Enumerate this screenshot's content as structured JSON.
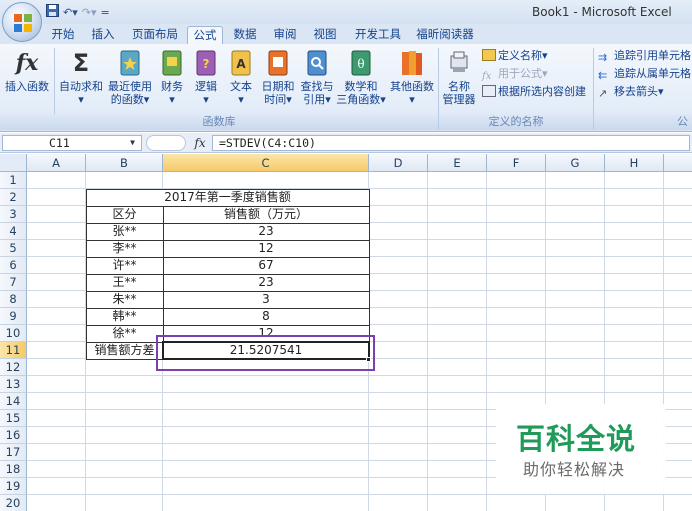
{
  "window": {
    "title": "Book1 - Microsoft Excel"
  },
  "tabs": [
    {
      "label": "开始"
    },
    {
      "label": "插入"
    },
    {
      "label": "页面布局"
    },
    {
      "label": "公式",
      "active": true
    },
    {
      "label": "数据"
    },
    {
      "label": "审阅"
    },
    {
      "label": "视图"
    },
    {
      "label": "开发工具"
    },
    {
      "label": "福昕阅读器"
    }
  ],
  "ribbon": {
    "function_library": {
      "group_label": "函数库",
      "buttons": [
        {
          "line1": "插入函数",
          "line2": "",
          "icon": "fx-icon"
        },
        {
          "line1": "自动求和",
          "line2": "▾",
          "icon": "sigma-icon"
        },
        {
          "line1": "最近使用",
          "line2": "的函数▾",
          "icon": "book-star-icon"
        },
        {
          "line1": "财务",
          "line2": "▾",
          "icon": "book-finance-icon"
        },
        {
          "line1": "逻辑",
          "line2": "▾",
          "icon": "book-logic-icon"
        },
        {
          "line1": "文本",
          "line2": "▾",
          "icon": "book-text-icon"
        },
        {
          "line1": "日期和",
          "line2": "时间▾",
          "icon": "book-date-icon"
        },
        {
          "line1": "查找与",
          "line2": "引用▾",
          "icon": "book-lookup-icon"
        },
        {
          "line1": "数学和",
          "line2": "三角函数▾",
          "icon": "book-math-icon"
        },
        {
          "line1": "其他函数",
          "line2": "▾",
          "icon": "book-more-icon"
        }
      ]
    },
    "defined_names": {
      "group_label": "定义的名称",
      "name_manager": {
        "line1": "名称",
        "line2": "管理器"
      },
      "define_name": "定义名称▾",
      "use_in_formula": "用于公式▾",
      "create_from_selection": "根据所选内容创建"
    },
    "formula_auditing": {
      "trace_precedents": "追踪引用单元格",
      "trace_dependents": "追踪从属单元格",
      "remove_arrows": "移去箭头▾",
      "group_label_partial": "公"
    }
  },
  "formula_bar": {
    "name_box": "C11",
    "fx_label": "fx",
    "formula": "=STDEV(C4:C10)"
  },
  "columns": [
    "A",
    "B",
    "C",
    "D",
    "E",
    "F",
    "G",
    "H"
  ],
  "rows": [
    "1",
    "2",
    "3",
    "4",
    "5",
    "6",
    "7",
    "8",
    "9",
    "10",
    "11",
    "12",
    "13",
    "14",
    "15",
    "16",
    "17",
    "18",
    "19",
    "20"
  ],
  "table": {
    "title": "2017年第一季度销售额",
    "header": {
      "region": "区分",
      "sales": "销售额（万元）"
    },
    "rows": [
      {
        "name": "张**",
        "value": "23"
      },
      {
        "name": "李**",
        "value": "12"
      },
      {
        "name": "许**",
        "value": "67"
      },
      {
        "name": "王**",
        "value": "23"
      },
      {
        "name": "朱**",
        "value": "3"
      },
      {
        "name": "韩**",
        "value": "8"
      },
      {
        "name": "徐**",
        "value": "12"
      }
    ],
    "result_label": "销售额方差",
    "result_value": "21.5207541"
  },
  "watermark": {
    "brand": "百科全说",
    "slogan": "助你轻松解决"
  },
  "colors": {
    "highlight_box": "#7a3fb0",
    "watermark_green": "#1f9a58"
  }
}
